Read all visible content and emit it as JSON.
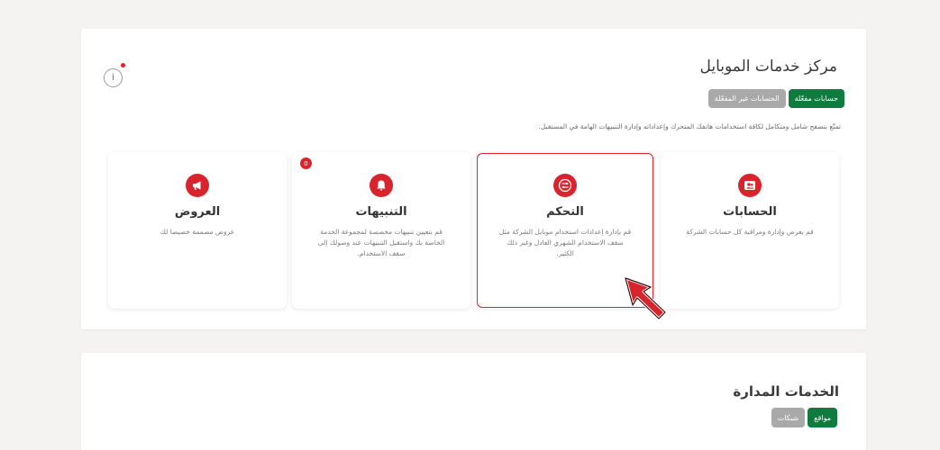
{
  "section1": {
    "title": "مركز خدمات الموبايل",
    "info_symbol": "i",
    "toggles": {
      "active_label": "حسابات مفعّلة",
      "inactive_label": "الحسابات غير المفعّلة"
    },
    "description": "تمتّع بتصفح شامل ومتكامل لكافة استخدامات هاتفك المتحرك وإعداداته وإدارة التنبيهات الهامة في المستقبل.",
    "cards": [
      {
        "title": "الحسابات",
        "text": "قم بعرض وإدارة ومراقبة كل حسابات الشركة",
        "icon": "accounts-icon"
      },
      {
        "title": "التحكم",
        "text": "قم بإدارة إعدادات استخدام موبايل الشركة مثل سقف الاستخدام الشهري العادل وغير ذلك الكثير.",
        "icon": "control-sliders-icon"
      },
      {
        "title": "التنبيهات",
        "text": "قم بتعيين تنبيهات مخصصة لمجموعة الخدمة الخاصة بك واستقبل التنبيهات عند وصولك إلى سقف الاستخدام.",
        "icon": "bell-icon",
        "badge": "0"
      },
      {
        "title": "العروض",
        "text": "عروض مصممة خصيصا لك",
        "icon": "megaphone-icon"
      }
    ]
  },
  "section2": {
    "title": "الخدمات المدارة",
    "toggles": {
      "active_label": "مواقع",
      "inactive_label": "شبكات"
    }
  },
  "colors": {
    "brand_red": "#d9232d",
    "brand_green": "#0f7b3e",
    "inactive_gray": "#a9a9a9",
    "background": "#f5f3f1"
  }
}
